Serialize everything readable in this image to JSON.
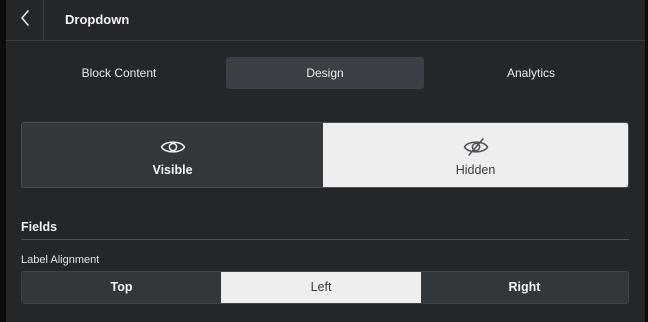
{
  "header": {
    "title": "Dropdown",
    "back_icon": "chevron-left-icon"
  },
  "tabs": [
    {
      "label": "Block Content",
      "active": false
    },
    {
      "label": "Design",
      "active": true
    },
    {
      "label": "Analytics",
      "active": false
    }
  ],
  "visibility": {
    "options": [
      {
        "label": "Visible",
        "icon": "eye-icon",
        "selected": true
      },
      {
        "label": "Hidden",
        "icon": "eye-off-icon",
        "selected": false
      }
    ]
  },
  "fields": {
    "heading": "Fields",
    "label_alignment": {
      "title": "Label Alignment",
      "options": [
        {
          "label": "Top",
          "selected": false
        },
        {
          "label": "Left",
          "selected": true
        },
        {
          "label": "Right",
          "selected": false
        }
      ]
    }
  },
  "colors": {
    "panel_bg": "#24272a",
    "segment_dark": "#32373c",
    "segment_light": "#eceeef",
    "active_tab": "#3a4046"
  }
}
